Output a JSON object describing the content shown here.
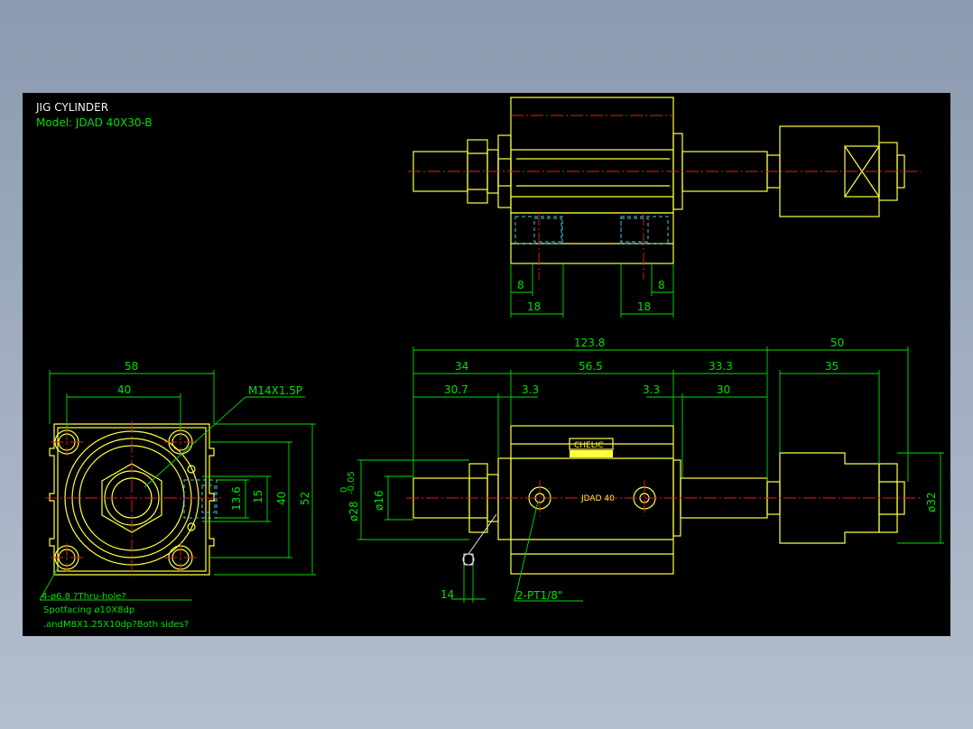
{
  "title_block": {
    "title": "JIG CYLINDER",
    "model": "Model:  JDAD  40X30-B"
  },
  "dimensions": {
    "front_width_58": "58",
    "front_width_40": "40",
    "front_thread": "M14X1.5P",
    "front_13_6": "13.6",
    "front_15": "15",
    "front_40_v": "40",
    "front_52": "52",
    "top_8_left": "8",
    "top_8_right": "8",
    "top_18_left": "18",
    "top_18_right": "18",
    "overall_123_8": "123.8",
    "overall_50": "50",
    "seg_34": "34",
    "seg_56_5": "56.5",
    "seg_33_3": "33.3",
    "seg_35": "35",
    "seg_30_7": "30.7",
    "seg_3_3_left": "3.3",
    "seg_3_3_right": "3.3",
    "seg_30": "30",
    "dia_28": "ø28",
    "dia_28_tol_upper": "0",
    "dia_28_tol_lower": "-0.05",
    "dia_16": "ø16",
    "dia_32": "ø32",
    "bottom_14": "14",
    "ports": "2-PT1/8\""
  },
  "notes": {
    "holes": "4-ø6.8  ?Thru-hole?",
    "spotfacing": "Spotfacing  ø10X8dp",
    "threads": ".andM8X1.25X10dp?Both  sides?"
  },
  "labels": {
    "nameplate_brand": "CHELIC",
    "body_mark": "JDAD 40"
  },
  "colors": {
    "outline": "#ffff40",
    "dimension": "#00e000",
    "centerline": "#e02020",
    "hidden": "#40c8e0",
    "title_text": "#f0f0f0"
  }
}
